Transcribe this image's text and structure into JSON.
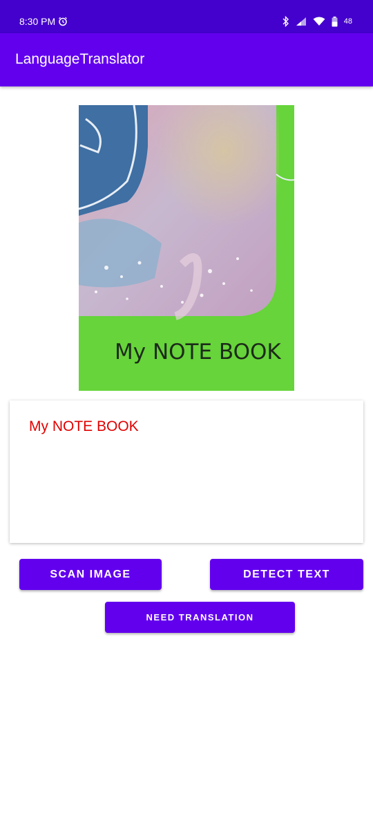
{
  "status_bar": {
    "time": "8:30 PM",
    "battery_level": "48",
    "icons": [
      "alarm-icon",
      "bluetooth-icon",
      "signal-icon",
      "wifi-icon",
      "battery-icon"
    ]
  },
  "app_bar": {
    "title": "LanguageTranslator"
  },
  "image_view": {
    "caption_in_image": "My NOTE BOOK"
  },
  "text_card": {
    "detected_text": "My NOTE BOOK"
  },
  "buttons": {
    "scan_image": "SCAN IMAGE",
    "detect_text": "DETECT TEXT",
    "need_translation": "NEED TRANSLATION"
  },
  "colors": {
    "status_bar": "#4400cc",
    "primary": "#6200ee",
    "detected_text": "#e00000",
    "notebook_green": "#66d43a"
  }
}
